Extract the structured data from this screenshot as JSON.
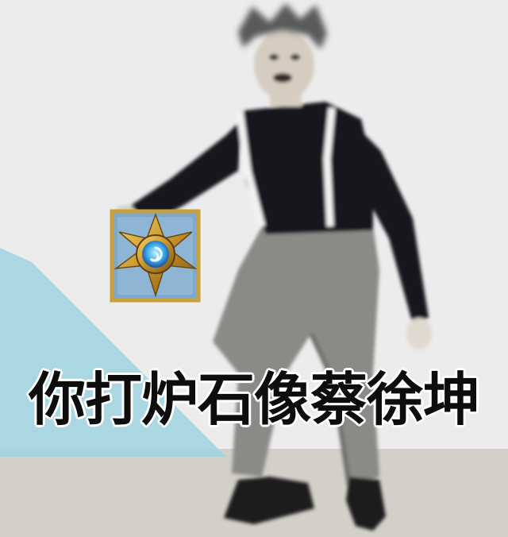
{
  "caption": "你打炉石像蔡徐坤",
  "colors": {
    "background": "#ebebeb",
    "floor": "#d3d0c9",
    "accent_stripe": "#9fd3e0",
    "sweater": "#17171c",
    "trousers": "#8a8a86",
    "suspenders": "#f2f2f2",
    "caption_text": "#0d0d0d"
  },
  "icons": {
    "game_logo": "hearthstone-logo-icon"
  }
}
